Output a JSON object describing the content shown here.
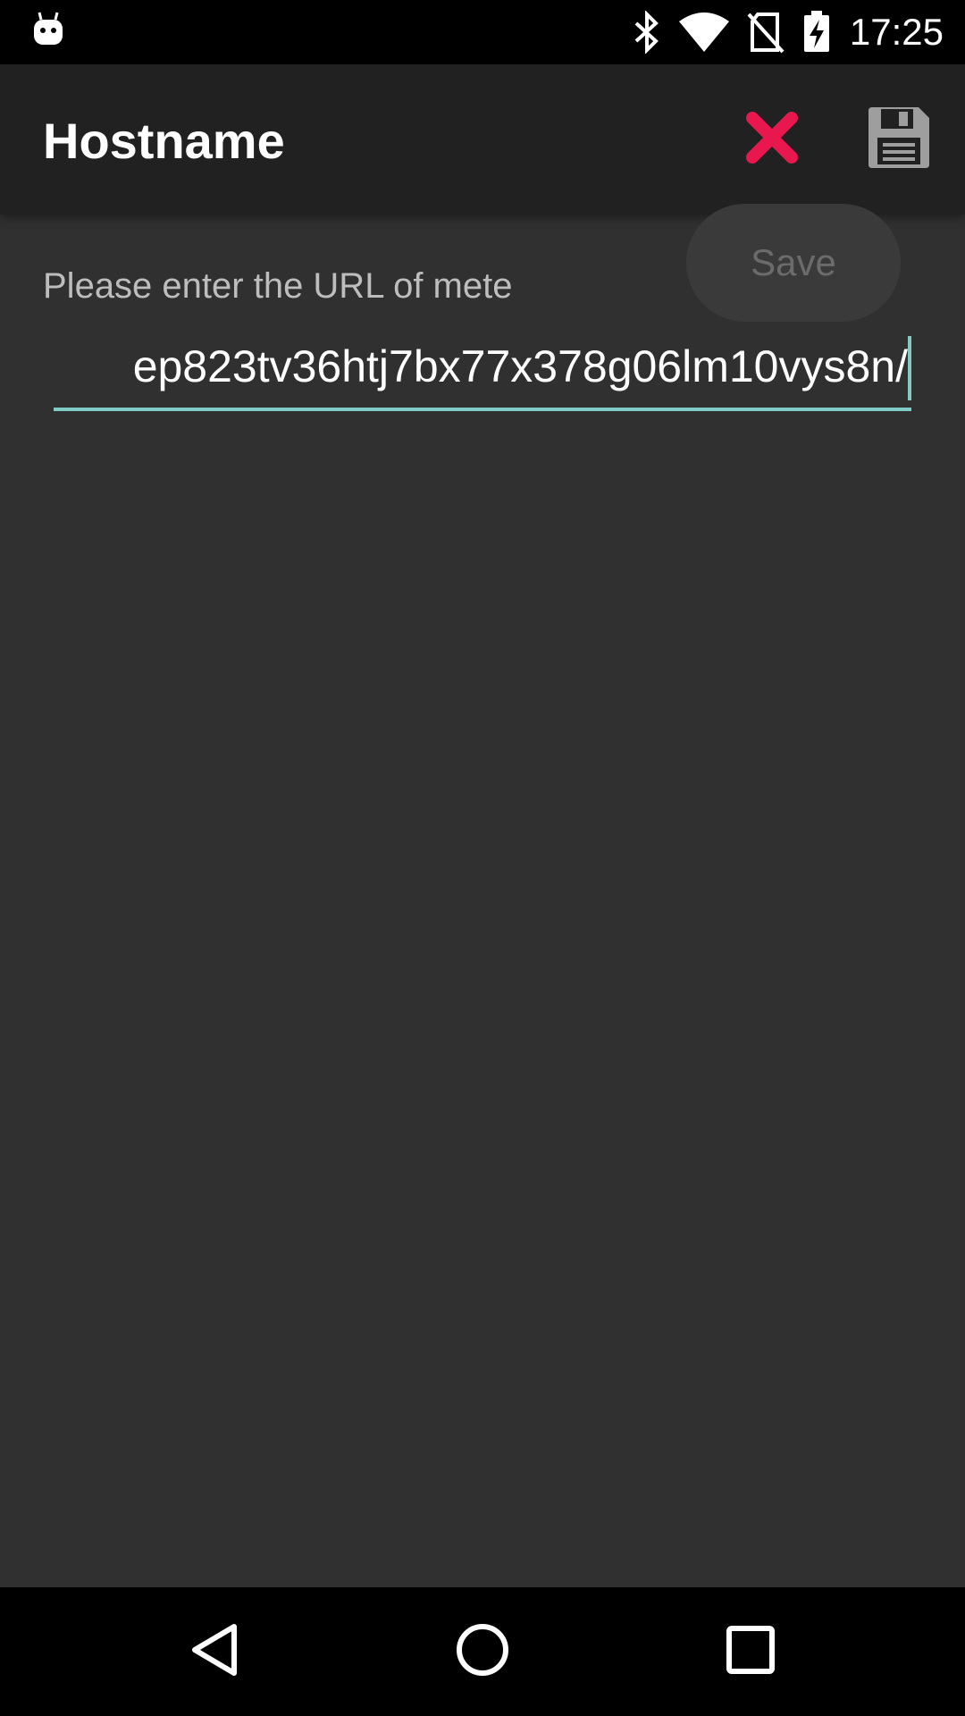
{
  "status_bar": {
    "time": "17:25",
    "icons": [
      "android-notification-icon",
      "bluetooth-icon",
      "wifi-icon",
      "no-sim-icon",
      "battery-charging-icon"
    ]
  },
  "app_bar": {
    "title": "Hostname",
    "actions": [
      {
        "name": "discard",
        "icon": "close-icon",
        "color": "#e8174e"
      },
      {
        "name": "save",
        "icon": "floppy-disk-icon",
        "color": "#9e9e9e"
      }
    ]
  },
  "form": {
    "prompt": "Please enter the URL of mete",
    "url_value": "ep823tv36htj7bx77x378g06lm10vys8n/",
    "underline_color": "#80cbc4"
  },
  "tooltip": {
    "label": "Save"
  },
  "nav_bar": {
    "buttons": [
      "back-icon",
      "home-icon",
      "recents-icon"
    ]
  }
}
